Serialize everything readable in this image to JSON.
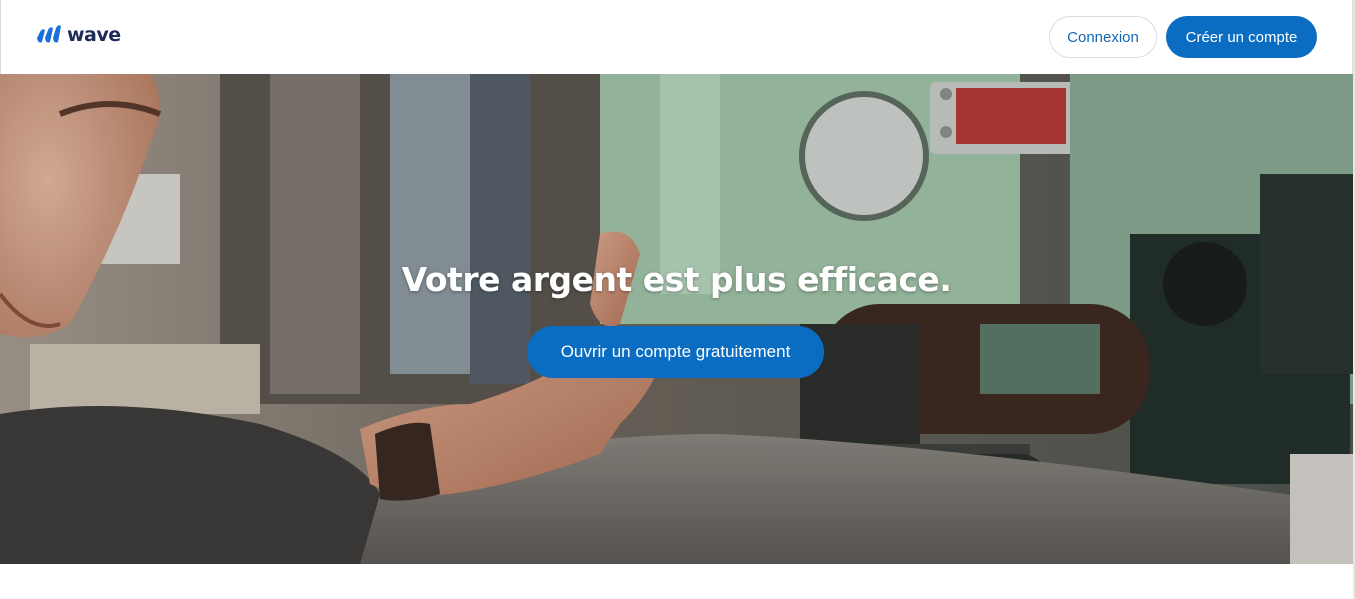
{
  "header": {
    "logo_text": "wave",
    "login_label": "Connexion",
    "signup_label": "Créer un compte"
  },
  "hero": {
    "title": "Votre argent est plus efficace.",
    "cta_label": "Ouvrir un compte gratuitement",
    "image_description_icon": "sewing-machine-photo"
  },
  "colors": {
    "brand_blue": "#0b6dc2",
    "logo_dark": "#1c2b5a",
    "link_blue": "#1468b3"
  }
}
